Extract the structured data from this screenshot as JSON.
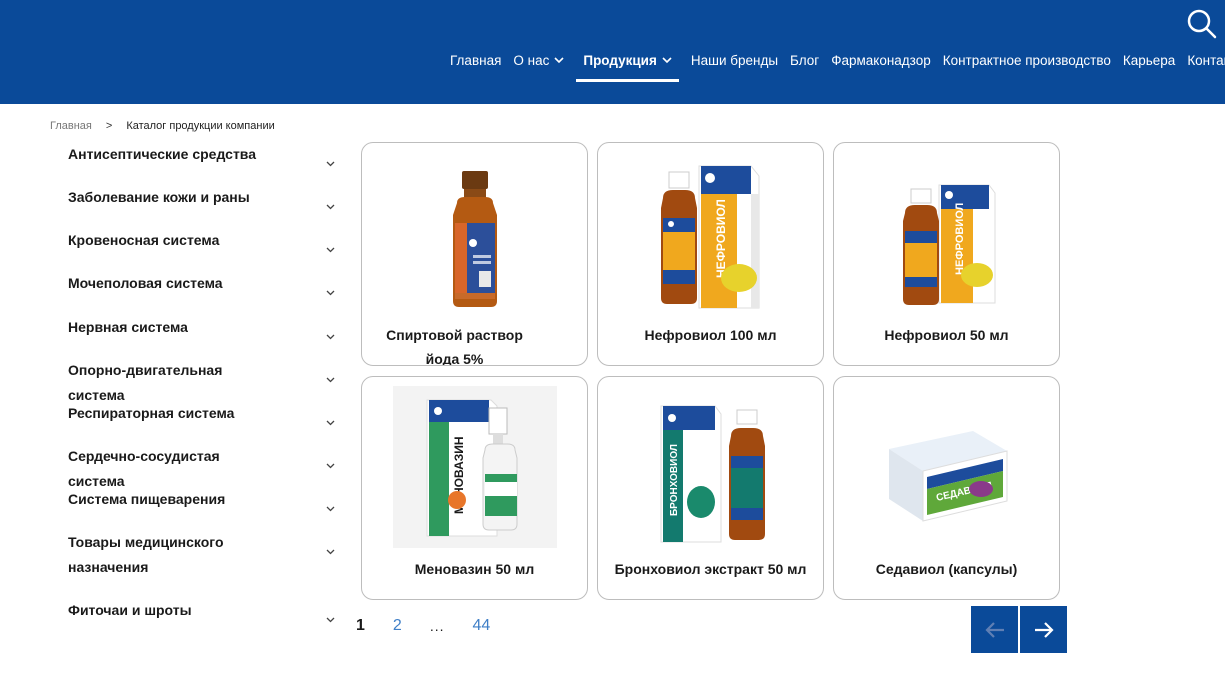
{
  "header": {
    "nav": [
      {
        "label": "Главная"
      },
      {
        "label": "О нас"
      },
      {
        "label": "Продукция"
      },
      {
        "label": "Наши бренды"
      },
      {
        "label": "Блог"
      },
      {
        "label": "Фармаконадзор"
      },
      {
        "label": "Контрактное производство"
      },
      {
        "label": "Карьера"
      },
      {
        "label": "Контакты"
      }
    ],
    "search_icon": "search-icon",
    "brand_color": "#0a4a99"
  },
  "breadcrumb": {
    "home": "Главная",
    "separator": ">",
    "current": "Каталог продукции компании"
  },
  "sidebar": {
    "items": [
      {
        "label": "Антисептические средства"
      },
      {
        "label": "Заболевание кожи и раны"
      },
      {
        "label": "Кровеносная система"
      },
      {
        "label": "Мочеполовая система"
      },
      {
        "label": "Нервная система"
      },
      {
        "label": "Опорно-двигательная система"
      },
      {
        "label": "Респираторная система"
      },
      {
        "label": "Сердечно-сосудистая система"
      },
      {
        "label": "Система пищеварения"
      },
      {
        "label": "Товары медицинского назначения"
      },
      {
        "label": "Фиточаи и шроты"
      }
    ]
  },
  "products": [
    {
      "title": "Спиртовой раствор йода 5%"
    },
    {
      "title": "Нефровиол 100 мл",
      "box_text": "НЕФРОВИОЛ"
    },
    {
      "title": "Нефровиол 50 мл",
      "box_text": "НЕФРОВИОЛ"
    },
    {
      "title": "Меновазин 50 мл",
      "box_text": "МЕНОВАЗИН"
    },
    {
      "title": "Бронховиол экстракт 50 мл",
      "box_text": "БРОНХОВИОЛ"
    },
    {
      "title": "Седавиол (капсулы)",
      "box_text": "СЕДАВИОЛ"
    }
  ],
  "pagination": {
    "current": "1",
    "next": "2",
    "dots": "...",
    "last": "44"
  }
}
